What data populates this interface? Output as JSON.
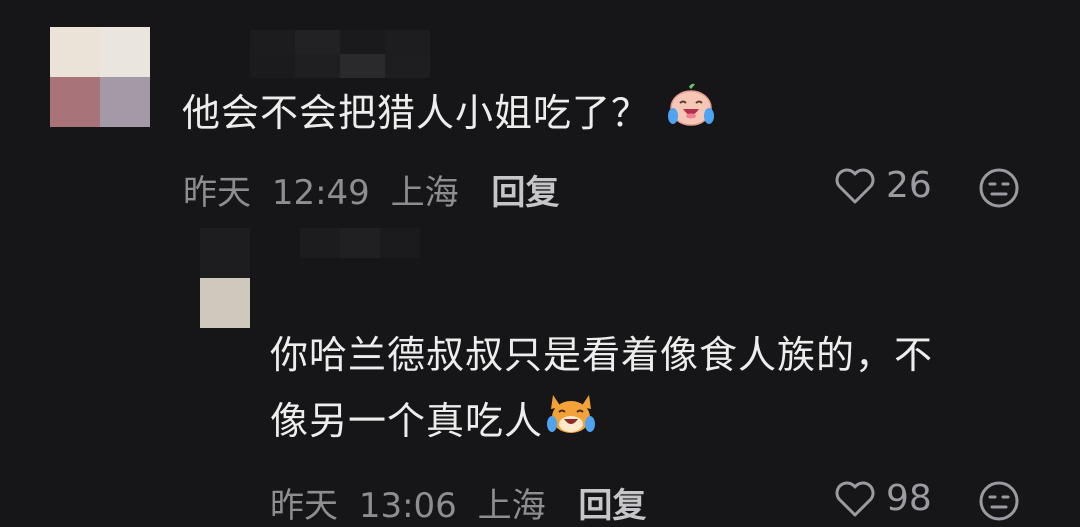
{
  "comments": [
    {
      "text": "他会不会把猎人小姐吃了？",
      "emoji": "crying-laughing-face-emoji",
      "date": "昨天",
      "time": "12:49",
      "location": "上海",
      "reply_label": "回复",
      "likes": "26",
      "like_icon": "heart-outline-icon",
      "dislike_icon": "dislike-face-icon"
    },
    {
      "text_line1": "你哈兰德叔叔只是看着像食人族的，不",
      "text_line2": "像另一个真吃人",
      "emoji": "crying-laughing-cat-emoji",
      "date": "昨天",
      "time": "13:06",
      "location": "上海",
      "reply_label": "回复",
      "likes": "98",
      "like_icon": "heart-outline-icon",
      "dislike_icon": "dislike-face-icon"
    }
  ],
  "colors": {
    "background": "#161618",
    "text": "#ededed",
    "meta": "#8d8d92",
    "reply": "#c6c6ca"
  }
}
